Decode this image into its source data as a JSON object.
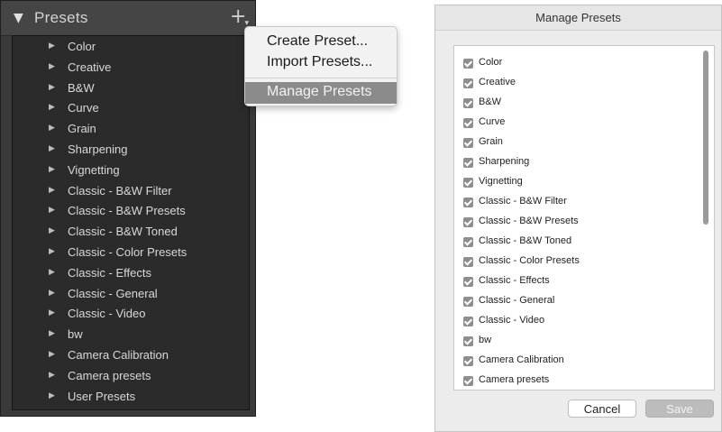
{
  "panel": {
    "title": "Presets",
    "collapse_icon": "▼",
    "add_icon": "+",
    "items": [
      "Color",
      "Creative",
      "B&W",
      "Curve",
      "Grain",
      "Sharpening",
      "Vignetting",
      "Classic - B&W Filter",
      "Classic - B&W Presets",
      "Classic - B&W Toned",
      "Classic - Color Presets",
      "Classic - Effects",
      "Classic - General",
      "Classic - Video",
      "bw",
      "Camera Calibration",
      "Camera presets",
      "User Presets"
    ]
  },
  "context_menu": {
    "items": [
      "Create Preset...",
      "Import Presets...",
      "Manage Presets"
    ],
    "selected": "Manage Presets"
  },
  "dialog": {
    "title": "Manage Presets",
    "items": [
      "Color",
      "Creative",
      "B&W",
      "Curve",
      "Grain",
      "Sharpening",
      "Vignetting",
      "Classic - B&W Filter",
      "Classic - B&W Presets",
      "Classic - B&W Toned",
      "Classic - Color Presets",
      "Classic - Effects",
      "Classic - General",
      "Classic - Video",
      "bw",
      "Camera Calibration",
      "Camera presets"
    ],
    "checked": true,
    "cancel_label": "Cancel",
    "save_label": "Save"
  },
  "colors": {
    "panel_bg": "#3a3a3a",
    "menu_highlight": "#8b8b8b",
    "checkbox": "#8e8e8e"
  }
}
